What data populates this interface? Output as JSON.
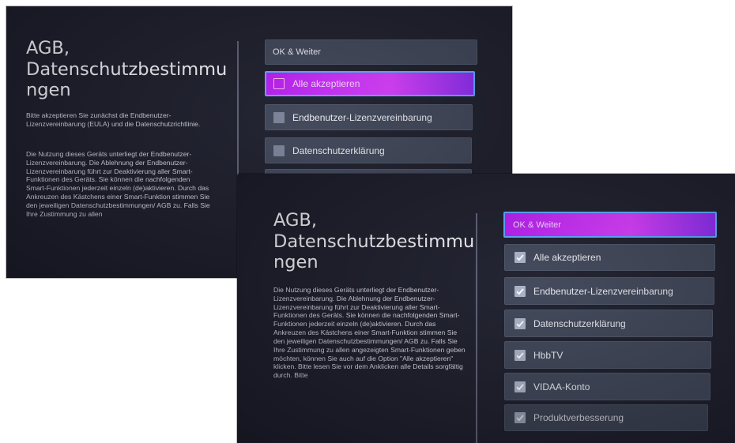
{
  "screen_a": {
    "title": "AGB, Datenschutzbestimmu ngen",
    "intro_text": "Bitte akzeptieren Sie zunächst die Endbenutzer-Lizenzvereinbarung (EULA) und die Datenschutzrichtlinie.",
    "body_text": "Die Nutzung dieses Geräts unterliegt der Endbenutzer-Lizenzvereinbarung. Die Ablehnung der Endbenutzer-Lizenzvereinbarung führt zur Deaktivierung aller Smart-Funktionen des Geräts. Sie können die nachfolgenden Smart-Funktionen jederzeit einzeln (de)aktivieren. Durch das Ankreuzen des Kästchens einer Smart-Funktion stimmen Sie den jeweiligen Datenschutzbestimmungen/ AGB zu. Falls Sie Ihre Zustimmung zu allen",
    "options": {
      "ok": "OK & Weiter",
      "accept_all": "Alle akzeptieren",
      "eula": "Endbenutzer-Lizenzvereinbarung",
      "privacy": "Datenschutzerklärung"
    },
    "focused_option": "accept_all",
    "checked": {
      "accept_all": false,
      "eula": false,
      "privacy": false
    }
  },
  "screen_b": {
    "title": "AGB, Datenschutzbestimmu ngen",
    "body_text": "Die Nutzung dieses Geräts unterliegt der Endbenutzer-Lizenzvereinbarung. Die Ablehnung der Endbenutzer-Lizenzvereinbarung führt zur Deaktivierung aller Smart-Funktionen des Geräts. Sie können die nachfolgenden Smart-Funktionen jederzeit einzeln (de)aktivieren. Durch das Ankreuzen des Kästchens einer Smart-Funktion stimmen Sie den jeweiligen Datenschutzbestimmungen/ AGB zu. Falls Sie Ihre Zustimmung zu allen angezeigten Smart-Funktionen geben möchten, können Sie auch auf die Option \"Alle akzeptieren\" klicken. Bitte lesen Sie vor dem Anklicken alle Details sorgfältig durch. Bitte",
    "options": {
      "ok": "OK & Weiter",
      "accept_all": "Alle akzeptieren",
      "eula": "Endbenutzer-Lizenzvereinbarung",
      "privacy": "Datenschutzerklärung",
      "hbbtv": "HbbTV",
      "vidaa": "VIDAA-Konto",
      "product": "Produktverbesserung"
    },
    "focused_option": "ok",
    "checked": {
      "accept_all": true,
      "eula": true,
      "privacy": true,
      "hbbtv": true,
      "vidaa": true,
      "product": true
    }
  },
  "colors": {
    "background": "#1c1d2b",
    "option": "#3d4456",
    "focus_gradient_start": "#b61cf0",
    "focus_gradient_end": "#8c2bf0",
    "focus_border": "#5aa7ff"
  }
}
